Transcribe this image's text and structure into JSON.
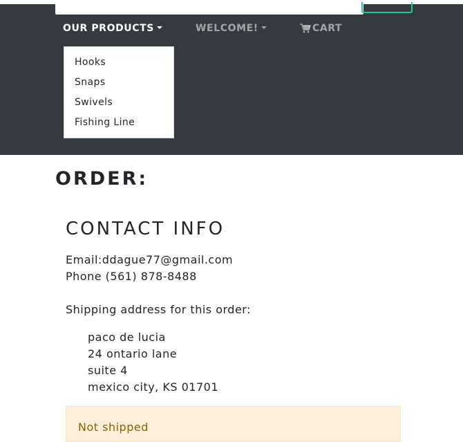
{
  "colors": {
    "navbar": "#343a40",
    "accent": "#20c997",
    "alert_bg": "#fdefd9",
    "alert_text": "#856404"
  },
  "nav": {
    "products_label": "OUR PRODUCTS",
    "welcome_label": "WELCOME!",
    "cart_label": "CART",
    "cart_icon": "shopping-cart-icon",
    "dropdown_items": [
      "Hooks",
      "Snaps",
      "Swivels",
      "Fishing Line"
    ]
  },
  "page": {
    "title": "ORDER:"
  },
  "contact": {
    "title": "CONTACT INFO",
    "email": "Email:ddague77@gmail.com",
    "phone": "Phone (561) 878-8488",
    "shipping_heading": "Shipping address for this order:",
    "address": [
      "paco de lucia",
      "24 ontario lane",
      "suite 4",
      "mexico city, KS 01701"
    ]
  },
  "status": {
    "text": "Not shipped"
  }
}
